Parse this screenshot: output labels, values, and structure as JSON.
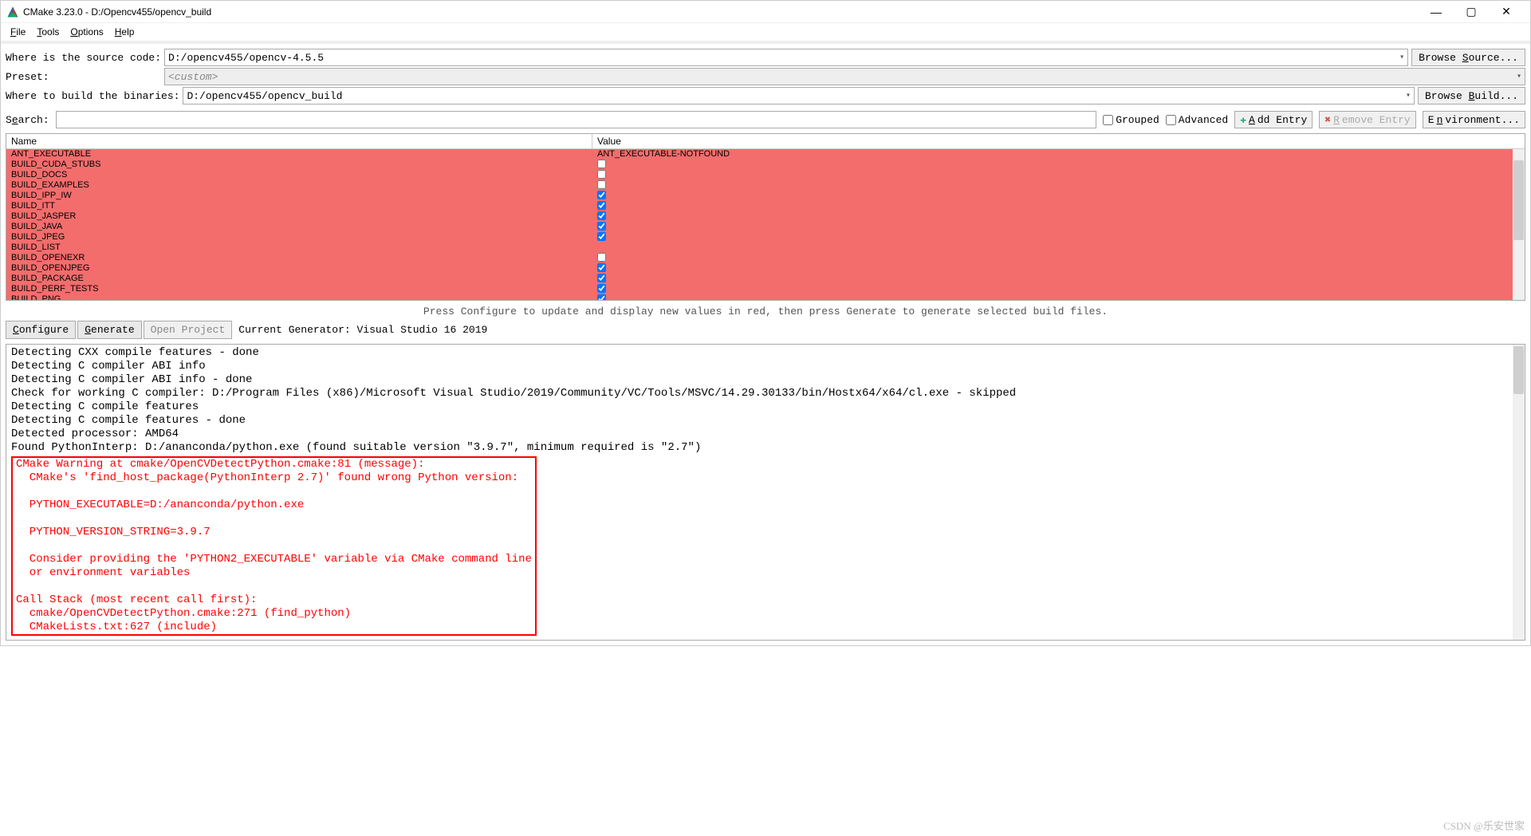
{
  "window": {
    "title": "CMake 3.23.0 - D:/Opencv455/opencv_build"
  },
  "menu": {
    "file": "File",
    "tools": "Tools",
    "options": "Options",
    "help": "Help"
  },
  "paths": {
    "src_label": "Where is the source code:",
    "src_value": "D:/opencv455/opencv-4.5.5",
    "src_btn": "Browse Source...",
    "preset_label": "Preset:",
    "preset_value": "<custom>",
    "build_label": "Where to build the binaries:",
    "build_value": "D:/opencv455/opencv_build",
    "build_btn": "Browse Build..."
  },
  "search": {
    "label": "Search:",
    "grouped": "Grouped",
    "advanced": "Advanced",
    "add": "Add Entry",
    "remove": "Remove Entry",
    "env": "Environment..."
  },
  "cache": {
    "col_name": "Name",
    "col_value": "Value",
    "rows": [
      {
        "n": "ANT_EXECUTABLE",
        "v": "ANT_EXECUTABLE-NOTFOUND",
        "t": "text"
      },
      {
        "n": "BUILD_CUDA_STUBS",
        "c": false,
        "t": "bool"
      },
      {
        "n": "BUILD_DOCS",
        "c": false,
        "t": "bool"
      },
      {
        "n": "BUILD_EXAMPLES",
        "c": false,
        "t": "bool"
      },
      {
        "n": "BUILD_IPP_IW",
        "c": true,
        "t": "bool"
      },
      {
        "n": "BUILD_ITT",
        "c": true,
        "t": "bool"
      },
      {
        "n": "BUILD_JASPER",
        "c": true,
        "t": "bool"
      },
      {
        "n": "BUILD_JAVA",
        "c": true,
        "t": "bool"
      },
      {
        "n": "BUILD_JPEG",
        "c": true,
        "t": "bool"
      },
      {
        "n": "BUILD_LIST",
        "v": "",
        "t": "text"
      },
      {
        "n": "BUILD_OPENEXR",
        "c": false,
        "t": "bool"
      },
      {
        "n": "BUILD_OPENJPEG",
        "c": true,
        "t": "bool"
      },
      {
        "n": "BUILD_PACKAGE",
        "c": true,
        "t": "bool"
      },
      {
        "n": "BUILD_PERF_TESTS",
        "c": true,
        "t": "bool"
      },
      {
        "n": "BUILD_PNG",
        "c": true,
        "t": "bool"
      }
    ]
  },
  "hint": "Press Configure to update and display new values in red, then press Generate to generate selected build files.",
  "toolbar": {
    "configure": "Configure",
    "generate": "Generate",
    "open": "Open Project",
    "genlabel": "Current Generator: Visual Studio 16 2019"
  },
  "log": {
    "lines": [
      "Detecting CXX compile features - done",
      "Detecting C compiler ABI info",
      "Detecting C compiler ABI info - done",
      "Check for working C compiler: D:/Program Files (x86)/Microsoft Visual Studio/2019/Community/VC/Tools/MSVC/14.29.30133/bin/Hostx64/x64/cl.exe - skipped",
      "Detecting C compile features",
      "Detecting C compile features - done",
      "Detected processor: AMD64",
      "Found PythonInterp: D:/ananconda/python.exe (found suitable version \"3.9.7\", minimum required is \"2.7\")"
    ],
    "warn": "CMake Warning at cmake/OpenCVDetectPython.cmake:81 (message):\n  CMake's 'find_host_package(PythonInterp 2.7)' found wrong Python version:\n\n  PYTHON_EXECUTABLE=D:/ananconda/python.exe\n\n  PYTHON_VERSION_STRING=3.9.7\n\n  Consider providing the 'PYTHON2_EXECUTABLE' variable via CMake command line\n  or environment variables\n\nCall Stack (most recent call first):\n  cmake/OpenCVDetectPython.cmake:271 (find_python)\n  CMakeLists.txt:627 (include)"
  },
  "watermark": "CSDN @乐安世家"
}
